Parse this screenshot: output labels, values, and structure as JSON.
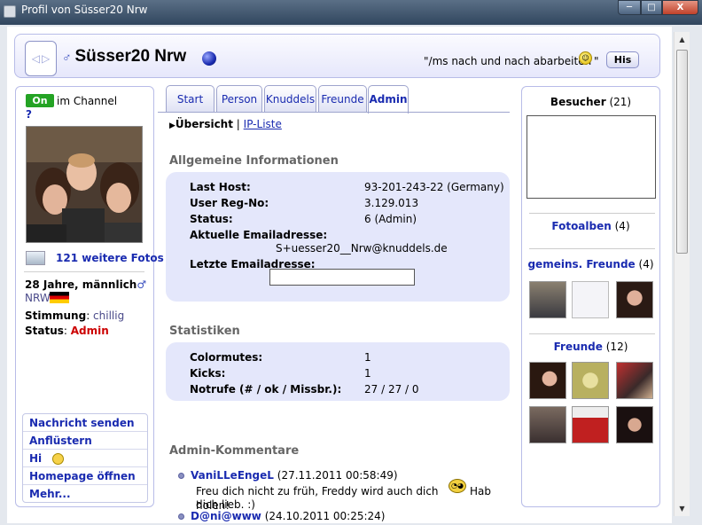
{
  "window": {
    "title": "Profil von Süsser20 Nrw",
    "min": "─",
    "max": "□",
    "close": "X"
  },
  "header": {
    "username": "Süsser20 Nrw",
    "gender_symbol": "♂",
    "status_text": "\"/ms nach und nach abarbeiten",
    "status_end": "\"",
    "his_button": "His",
    "nav_left": "◁",
    "nav_right": "▷"
  },
  "left": {
    "online_badge": "On",
    "in_channel": "im Channel",
    "help": "?",
    "more_photos": "121 weitere Fotos",
    "age_gender": "28 Jahre, männlich",
    "gender_symbol": "♂",
    "region": "NRW",
    "mood_label": "Stimmung",
    "mood_value": "chillig",
    "status_label": "Status",
    "status_value": "Admin",
    "actions": [
      "Nachricht senden",
      "Anflüstern",
      "Hi",
      "Homepage öffnen",
      "Mehr..."
    ]
  },
  "tabs": [
    "Start",
    "Person",
    "Knuddels",
    "Freunde",
    "Admin"
  ],
  "subnav": {
    "active": "Übersicht",
    "sep": "|",
    "link": "IP-Liste"
  },
  "info": {
    "title": "Allgemeine Informationen",
    "rows": [
      {
        "label": "Last Host:",
        "value": "93-201-243-22 (Germany)"
      },
      {
        "label": "User Reg-No:",
        "value": "3.129.013"
      },
      {
        "label": "Status:",
        "value": "6 (Admin)"
      }
    ],
    "email_label": "Aktuelle Emailadresse:",
    "email_value": "S+uesser20__Nrw@knuddels.de",
    "last_email_label": "Letzte Emailadresse:"
  },
  "stats": {
    "title": "Statistiken",
    "rows": [
      {
        "label": "Colormutes:",
        "value": "1"
      },
      {
        "label": "Kicks:",
        "value": "1"
      },
      {
        "label": "Notrufe (# / ok / Missbr.):",
        "value": "27 / 27 / 0"
      }
    ]
  },
  "comments": {
    "title": "Admin-Kommentare",
    "items": [
      {
        "author": "VaniLLeEngeL",
        "date": "(27.11.2011 00:58:49)",
        "text_a": "Freu dich nicht zu früh, Freddy wird auch dich holen!",
        "text_b": "Hab dich lieb. :)"
      },
      {
        "author": "D@ni@www",
        "date": "(24.10.2011 00:25:24)"
      }
    ]
  },
  "right": {
    "visitors_label": "Besucher",
    "visitors_count": "(21)",
    "albums_label": "Fotoalben",
    "albums_count": "(4)",
    "mutual_label": "gemeins. Freunde",
    "mutual_count": "(4)",
    "friends_label": "Freunde",
    "friends_count": "(12)"
  },
  "colors": {
    "link": "#1a2bb0",
    "panel_border": "#b8bce8",
    "box_bg": "#e4e7fb",
    "online": "#24a324",
    "admin": "#cc0000"
  },
  "icons": [
    "window-icon",
    "nav-arrows-icon",
    "male-icon",
    "online-ball-icon",
    "smiley-icon",
    "photos-icon",
    "flag-germany-icon",
    "hi-smiley-icon",
    "clock-smiley-icon",
    "scroll-up-icon",
    "scroll-down-icon"
  ]
}
